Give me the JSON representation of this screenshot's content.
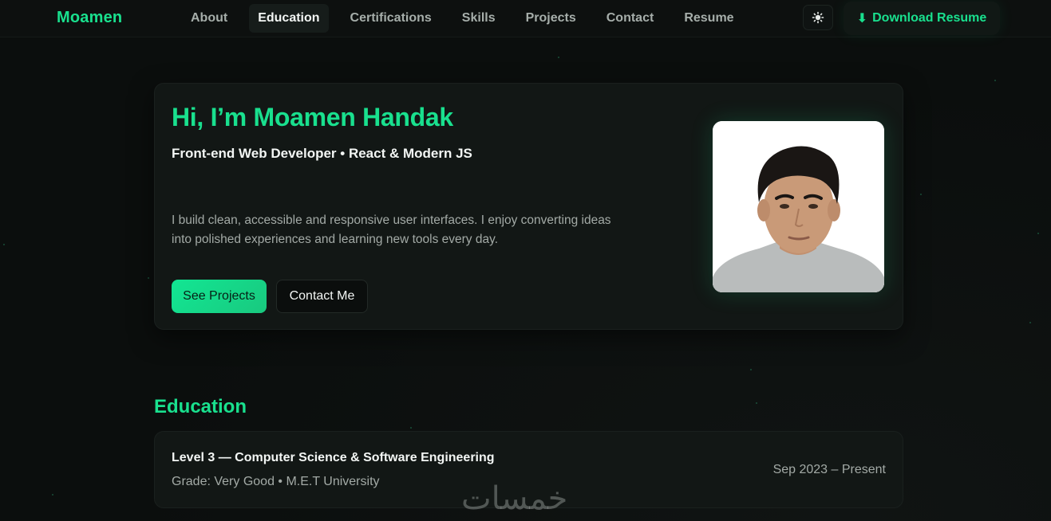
{
  "nav": {
    "brand": "Moamen",
    "links": [
      {
        "label": "About",
        "active": false
      },
      {
        "label": "Education",
        "active": true
      },
      {
        "label": "Certifications",
        "active": false
      },
      {
        "label": "Skills",
        "active": false
      },
      {
        "label": "Projects",
        "active": false
      },
      {
        "label": "Contact",
        "active": false
      },
      {
        "label": "Resume",
        "active": false
      }
    ],
    "theme_toggle_icon": "sun-icon",
    "download": {
      "icon": "⬇",
      "label": "Download Resume"
    }
  },
  "hero": {
    "title": "Hi, I’m Moamen Handak",
    "subtitle": "Front-end Web Developer • React & Modern JS",
    "description": "I build clean, accessible and responsive user interfaces. I enjoy converting ideas into polished experiences and learning new tools every day.",
    "primary_button": "See Projects",
    "secondary_button": "Contact Me"
  },
  "education": {
    "title": "Education",
    "items": [
      {
        "degree": "Level 3 — Computer Science & Software Engineering",
        "meta": "Grade: Very Good • M.E.T University",
        "date": "Sep 2023 – Present"
      }
    ]
  },
  "watermark": "خمسات",
  "colors": {
    "accent": "#19e08e",
    "background": "#0b0e0d",
    "card": "#121715",
    "muted_text": "#a3aaa6"
  }
}
